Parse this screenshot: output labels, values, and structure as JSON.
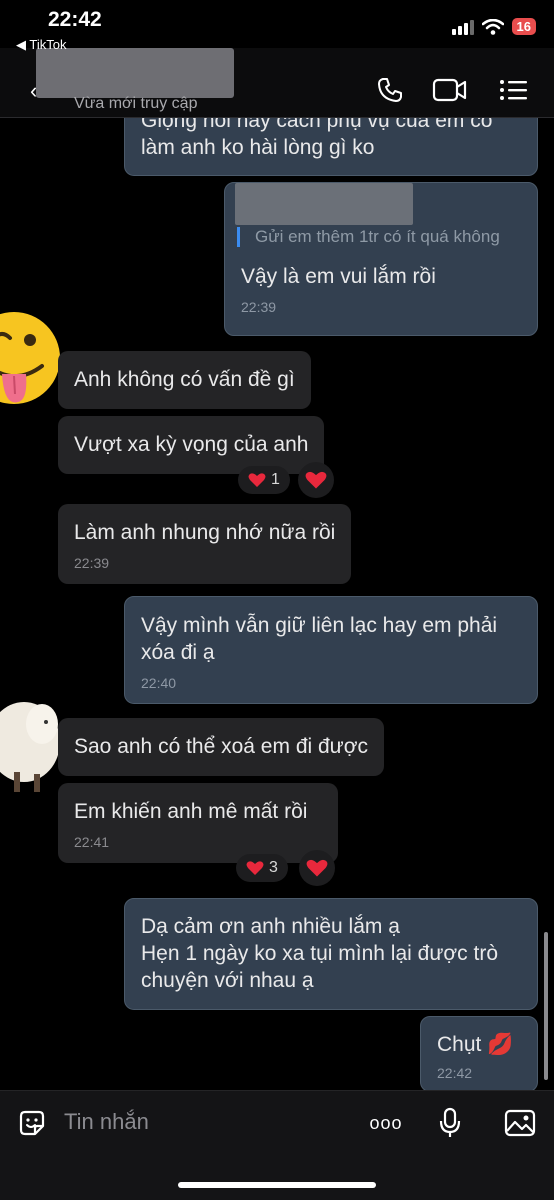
{
  "status": {
    "time": "22:42",
    "back_app": "◀ TikTok",
    "battery": "16"
  },
  "header": {
    "presence": "Vừa mới truy cập"
  },
  "messages": {
    "m0": {
      "line1": "Giọng nói hay cách phụ vụ của em có",
      "line2": "làm anh ko hài lòng gì ko"
    },
    "m1": {
      "quote": "Gửi em thêm 1tr có ít quá không",
      "text": "Vậy là em vui lắm rồi",
      "time": "22:39"
    },
    "m2": {
      "text": "Anh không có vấn đề gì"
    },
    "m3": {
      "text": "Vượt xa kỳ vọng của anh",
      "reaction_count": "1"
    },
    "m4": {
      "text": "Làm anh nhung nhớ nữa rồi",
      "time": "22:39"
    },
    "m5": {
      "line1": "Vậy mình vẫn giữ liên lạc hay em phải",
      "line2": "xóa đi ạ",
      "time": "22:40"
    },
    "m6": {
      "text": "Sao anh có thể xoá em đi được"
    },
    "m7": {
      "text": "Em khiến anh mê mất rồi",
      "time": "22:41",
      "reaction_count": "3"
    },
    "m8": {
      "line1": "Dạ cảm ơn anh nhiều lắm ạ",
      "line2": "Hẹn 1 ngày ko xa tụi mình lại được trò",
      "line3": "chuyện với nhau ạ"
    },
    "m9": {
      "text": "Chụt 💋",
      "time": "22:42"
    }
  },
  "input": {
    "placeholder": "Tin nhắn",
    "more": "ooo"
  },
  "colors": {
    "mine_bubble": "#334050",
    "their_bubble": "#242426",
    "quote_bar": "#3b8cf0",
    "heart": "#e8283c"
  },
  "icons": [
    "phone-icon",
    "video-icon",
    "menu-icon",
    "sticker-icon",
    "mic-icon",
    "image-icon",
    "heart-icon"
  ]
}
